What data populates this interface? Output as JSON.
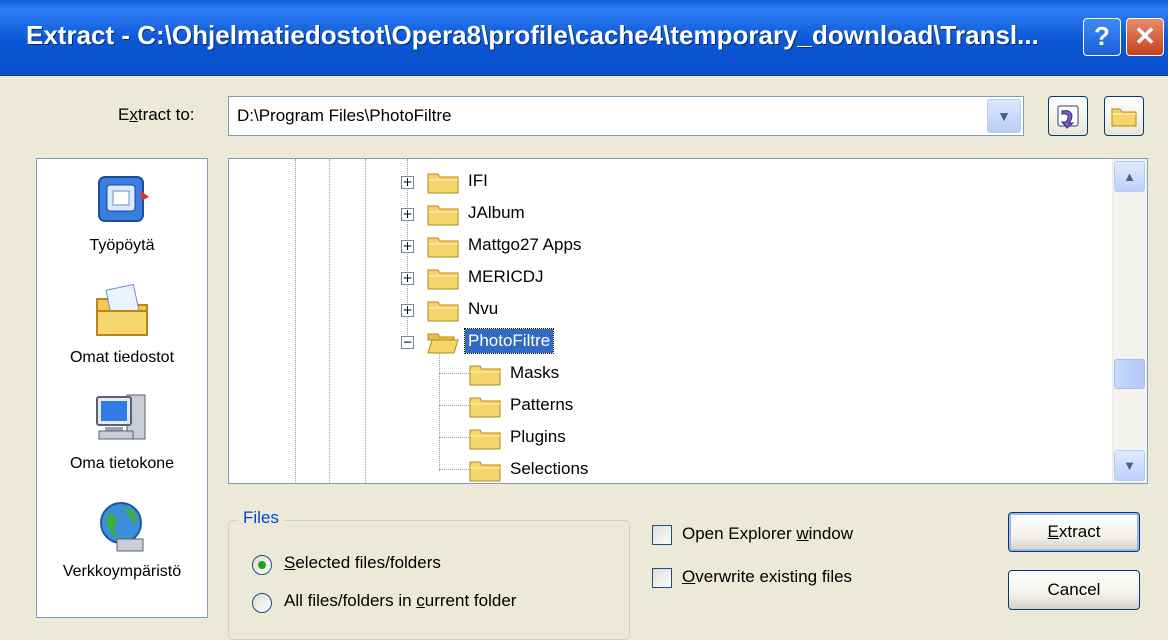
{
  "window": {
    "title": "Extract - C:\\Ohjelmatiedostot\\Opera8\\profile\\cache4\\temporary_download\\Transl...",
    "help_label": "?",
    "close_label": "✕"
  },
  "extract_to": {
    "label_prefix": "E",
    "label_underlined": "x",
    "label_suffix": "tract to:",
    "value": "D:\\Program Files\\PhotoFiltre",
    "dropdown_glyph": "▼"
  },
  "places": [
    {
      "label": "Työpöytä",
      "icon": "desktop-icon"
    },
    {
      "label": "Omat tiedostot",
      "icon": "my-documents-icon"
    },
    {
      "label": "Oma tietokone",
      "icon": "my-computer-icon"
    },
    {
      "label": "Verkkoympäristö",
      "icon": "network-icon"
    }
  ],
  "tree": {
    "items": [
      {
        "label": "IFI",
        "expander": "+"
      },
      {
        "label": "JAlbum",
        "expander": "+"
      },
      {
        "label": "Mattgo27 Apps",
        "expander": "+"
      },
      {
        "label": "MERICDJ",
        "expander": "+"
      },
      {
        "label": "Nvu",
        "expander": "+"
      },
      {
        "label": "PhotoFiltre",
        "expander": "−",
        "selected": true
      },
      {
        "label": "Masks",
        "expander": ""
      },
      {
        "label": "Patterns",
        "expander": ""
      },
      {
        "label": "Plugins",
        "expander": ""
      },
      {
        "label": "Selections",
        "expander": ""
      }
    ],
    "scroll_up_glyph": "▲",
    "scroll_down_glyph": "▼"
  },
  "files_group": {
    "title": "Files",
    "options": [
      {
        "pre": "",
        "ul": "S",
        "post": "elected files/folders",
        "checked": true
      },
      {
        "pre": "All files/folders in ",
        "ul": "c",
        "post": "urrent folder",
        "checked": false
      }
    ]
  },
  "options": [
    {
      "pre": "Open Explorer ",
      "ul": "w",
      "post": "indow",
      "checked": false
    },
    {
      "pre": "",
      "ul": "O",
      "post": "verwrite existing files",
      "checked": false
    }
  ],
  "buttons": {
    "extract": {
      "ul": "E",
      "post": "xtract"
    },
    "cancel": "Cancel"
  },
  "colors": {
    "titlebar": "#0a56d4",
    "dialog_bg": "#ece9d8",
    "selection": "#316ac5",
    "group_title": "#0046d5"
  }
}
